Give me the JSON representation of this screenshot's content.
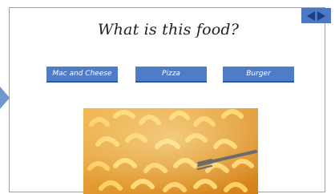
{
  "quiz": {
    "question": "What is this food?",
    "choices": [
      {
        "label": "Mac and Cheese"
      },
      {
        "label": "Pizza"
      },
      {
        "label": "Burger"
      }
    ]
  },
  "navigation": {
    "prev_icon": "arrow-left-icon",
    "next_icon": "arrow-right-icon"
  },
  "image": {
    "subject": "macaroni and cheese",
    "description": "Bowl of elbow macaroni in cheese sauce with a fork"
  },
  "colors": {
    "accent": "#4f7cc6",
    "border": "#7fa6d4",
    "nav_bg": "#4d78c4"
  }
}
